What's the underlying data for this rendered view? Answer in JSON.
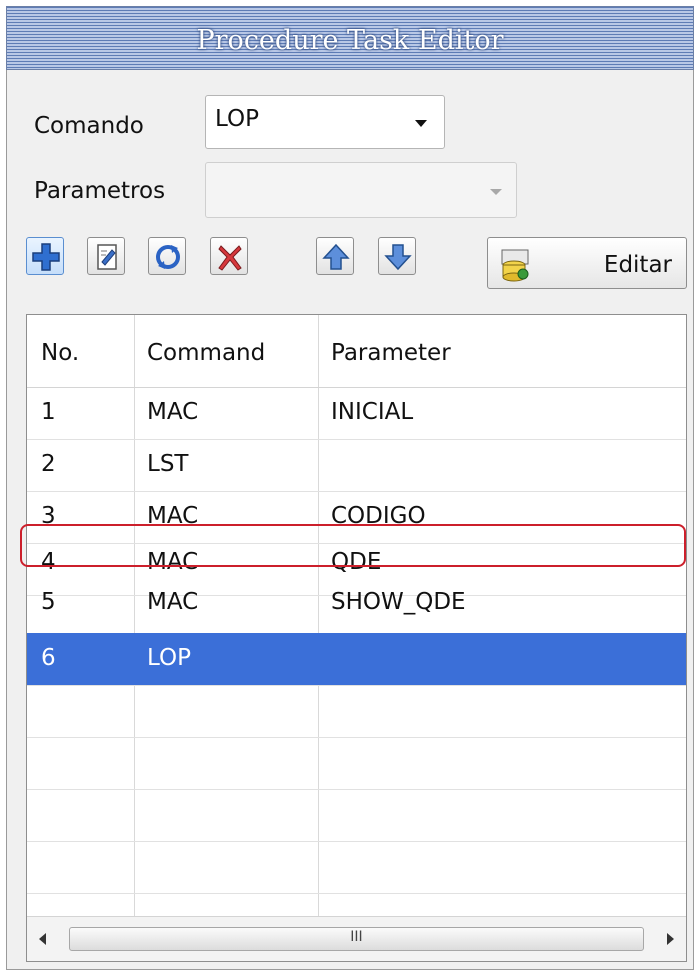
{
  "window": {
    "title": "Procedure Task Editor"
  },
  "form": {
    "command_label": "Comando",
    "command_value": "LOP",
    "params_label": "Parametros",
    "params_value": ""
  },
  "toolbar": {
    "buttons": [
      "add-icon",
      "edit-doc-icon",
      "refresh-icon",
      "delete-icon",
      "move-up-icon",
      "move-down-icon"
    ],
    "edit_label": "Editar"
  },
  "table": {
    "columns": [
      "No.",
      "Command",
      "Parameter"
    ],
    "rows": [
      [
        "1",
        "MAC",
        "INICIAL"
      ],
      [
        "2",
        "LST",
        ""
      ],
      [
        "3",
        "MAC",
        "CODIGO"
      ],
      [
        "4",
        "MAC",
        "QDE"
      ],
      [
        "5",
        "MAC",
        "SHOW_QDE"
      ],
      [
        "6",
        "LOP",
        ""
      ]
    ],
    "selected_row": 6
  },
  "scrollbar": {
    "thumb_glyph": "III"
  },
  "colors": {
    "selection": "#3b6fd8",
    "title_bar": "#5e7cb5",
    "highlight_box": "#cc1f2b"
  }
}
